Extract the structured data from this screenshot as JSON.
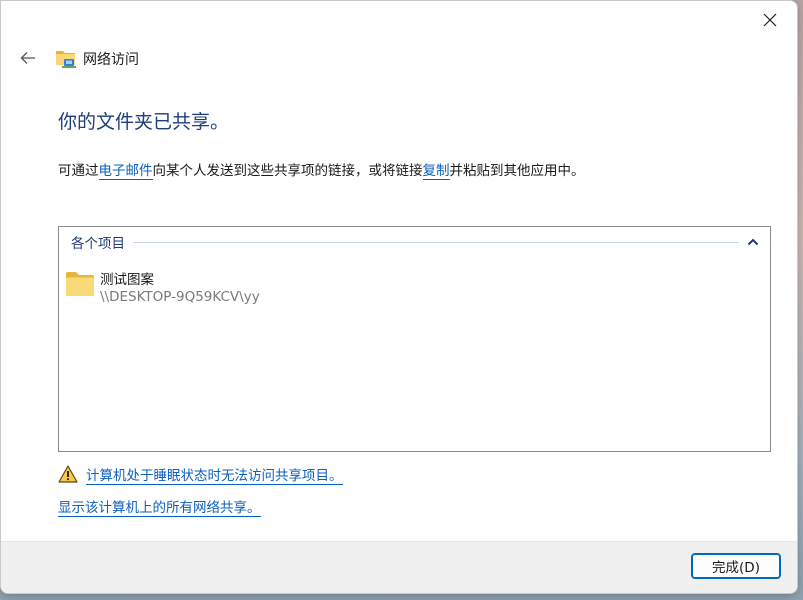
{
  "window": {
    "title": "网络访问"
  },
  "main": {
    "heading": "你的文件夹已共享。",
    "desc_prefix": "可通过",
    "email_link": "电子邮件",
    "desc_middle": "向某个人发送到这些共享项的链接，或将链接",
    "copy_link": "复制",
    "desc_suffix": "并粘贴到其他应用中。"
  },
  "items_group": {
    "label": "各个项目",
    "items": [
      {
        "name": "测试图案",
        "path": "\\\\DESKTOP-9Q59KCV\\yy",
        "icon": "folder-icon"
      }
    ]
  },
  "warning": {
    "icon": "warning-icon",
    "text": "计算机处于睡眠状态时无法访问共享项目。"
  },
  "show_all_link": "显示该计算机上的所有网络共享。",
  "footer": {
    "done_label": "完成(D)"
  },
  "colors": {
    "heading": "#1c3f7c",
    "link": "#0b5fbf",
    "accent": "#0067c0",
    "folder": "#f8d775"
  }
}
